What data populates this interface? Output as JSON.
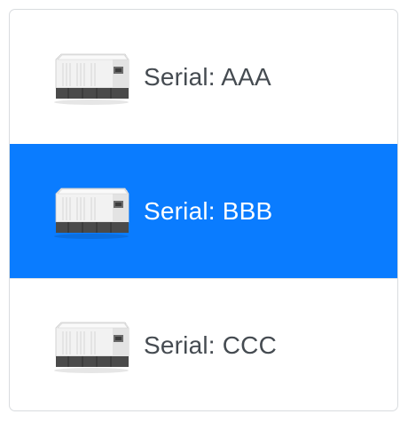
{
  "list": {
    "active_color": "#0a7cff",
    "items": [
      {
        "label": "Serial: AAA",
        "icon": "generator-icon",
        "active": false
      },
      {
        "label": "Serial: BBB",
        "icon": "generator-icon",
        "active": true
      },
      {
        "label": "Serial: CCC",
        "icon": "generator-icon",
        "active": false
      }
    ]
  }
}
